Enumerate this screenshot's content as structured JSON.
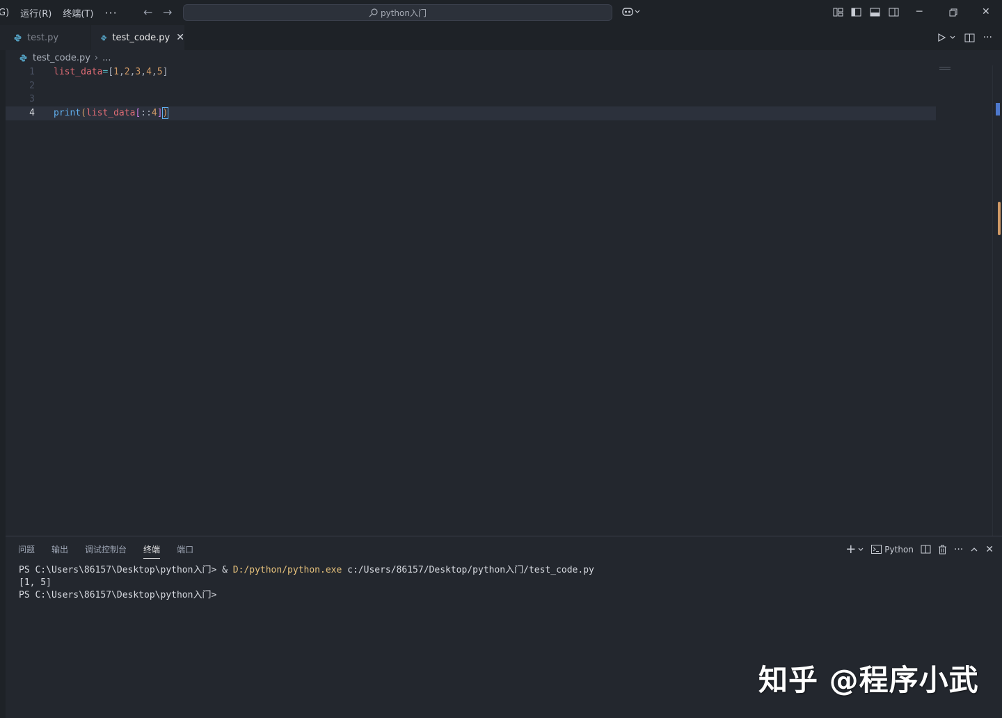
{
  "menu": {
    "items": [
      "G)",
      "运行(R)",
      "终端(T)"
    ],
    "more": "···"
  },
  "search": {
    "text": "python入门"
  },
  "tabs": [
    {
      "label": "test.py",
      "active": false
    },
    {
      "label": "test_code.py",
      "active": true,
      "close": "✕"
    }
  ],
  "breadcrumb": {
    "file": "test_code.py",
    "separator": "›",
    "more": "..."
  },
  "editor": {
    "lines": [
      {
        "number": "1",
        "code": "list_data=[1,2,3,4,5]"
      },
      {
        "number": "2",
        "code": ""
      },
      {
        "number": "3",
        "code": ""
      },
      {
        "number": "4",
        "code": "print(list_data[::4])",
        "current": true
      }
    ]
  },
  "panel": {
    "tabs": [
      "问题",
      "输出",
      "调试控制台",
      "终端",
      "端口"
    ],
    "active_tab": "终端",
    "terminal_profile": "Python",
    "terminal": {
      "line1_prompt": "PS C:\\Users\\86157\\Desktop\\python入门> ",
      "line1_amp": "& ",
      "line1_exe": "D:/python/python.exe",
      "line1_arg": " c:/Users/86157/Desktop/python入门/test_code.py",
      "line2": "[1, 5]",
      "line3": "PS C:\\Users\\86157\\Desktop\\python入门> "
    }
  },
  "watermark": "知乎 @程序小武",
  "colors": {
    "background": "#23272e",
    "titlebar": "#1e2227",
    "keyword_variable": "#e06c75",
    "function": "#61afef",
    "number": "#d19a66",
    "operator": "#56b6c2",
    "exe_path": "#e5c07b"
  }
}
